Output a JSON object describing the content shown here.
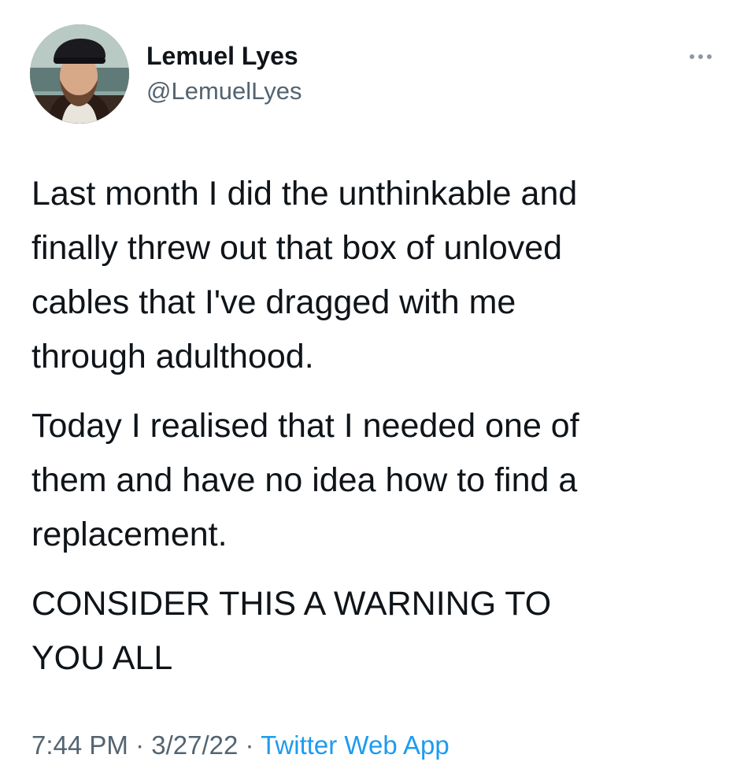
{
  "author": {
    "display_name": "Lemuel Lyes",
    "handle": "@LemuelLyes"
  },
  "more_icon": "more-horizontal-icon",
  "tweet": {
    "paragraphs": [
      "Last month I did the unthinkable and\nfinally threw out that box of unloved\ncables that I've dragged with me\nthrough adulthood.",
      "Today I realised that I needed one of\nthem and have no idea how to find a\nreplacement.",
      "CONSIDER THIS A WARNING TO\nYOU ALL"
    ]
  },
  "meta": {
    "time": "7:44 PM",
    "separator": " · ",
    "date": "3/27/22",
    "source": "Twitter Web App"
  },
  "colors": {
    "text": "#0f1419",
    "secondary": "#536471",
    "link": "#1d9bf0"
  }
}
